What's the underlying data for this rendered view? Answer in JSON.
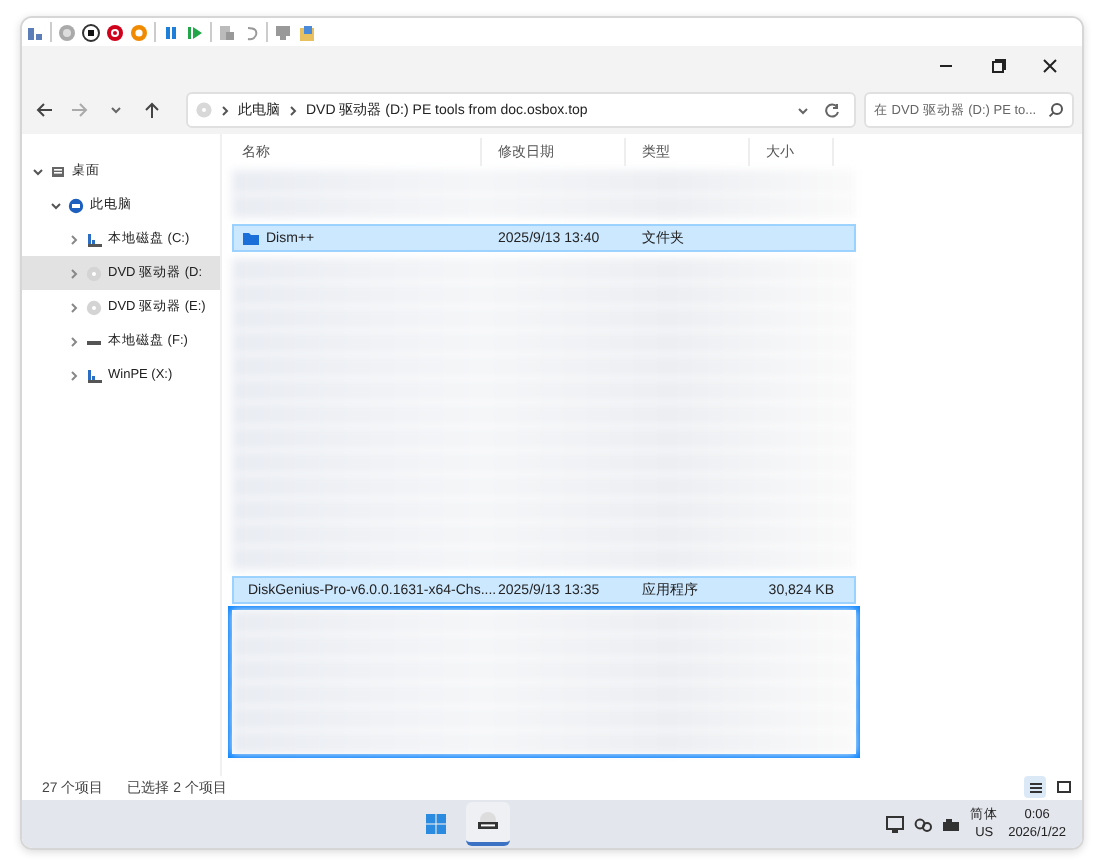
{
  "address": {
    "segments": [
      "此电脑",
      "DVD 驱动器 (D:) PE tools from doc.osbox.top"
    ]
  },
  "search": {
    "placeholder": "在 DVD 驱动器 (D:) PE to..."
  },
  "sidebar": {
    "items": [
      {
        "label": "桌面",
        "kind": "desktop",
        "expanded": true,
        "selected": false,
        "children": [
          {
            "label": "此电脑",
            "kind": "pc",
            "expanded": true,
            "selected": false,
            "children": [
              {
                "label": "本地磁盘 (C:)",
                "kind": "windisk",
                "expanded": false,
                "selected": false
              },
              {
                "label": "DVD 驱动器 (D:",
                "kind": "dvd",
                "expanded": false,
                "selected": true
              },
              {
                "label": "DVD 驱动器 (E:)",
                "kind": "dvd",
                "expanded": false,
                "selected": false
              },
              {
                "label": "本地磁盘 (F:)",
                "kind": "disk",
                "expanded": false,
                "selected": false
              },
              {
                "label": "WinPE (X:)",
                "kind": "windisk",
                "expanded": false,
                "selected": false
              }
            ]
          }
        ]
      }
    ]
  },
  "table": {
    "columns": [
      "名称",
      "修改日期",
      "类型",
      "大小"
    ],
    "rows": [
      {
        "kind": "blurred",
        "selected": false,
        "outlined": false
      },
      {
        "kind": "folder",
        "name": "Dism++",
        "date": "2025/9/13 13:40",
        "type": "文件夹",
        "selected": true
      },
      {
        "kind": "blurred",
        "selected": false,
        "outlined": false
      },
      {
        "kind": "application",
        "name": "DiskGenius-Pro-v6.0.0.1631-x64-Chs....",
        "date": "2025/9/13 13:35",
        "type": "应用程序",
        "size": "30,824 KB",
        "selected": true
      },
      {
        "kind": "blurred",
        "selected": false,
        "outlined": true
      }
    ]
  },
  "status_bar": {
    "count": "27 个项目",
    "selection": "已选择 2 个项目"
  },
  "taskbar": {
    "language": "简体",
    "layout": "US",
    "time": "0:06",
    "date": "2026/1/22"
  }
}
